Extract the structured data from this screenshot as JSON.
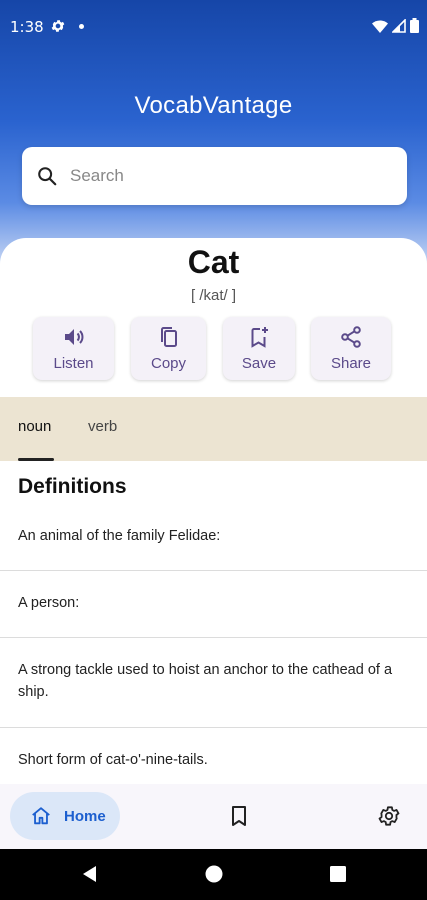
{
  "status_bar": {
    "time": "1:38"
  },
  "app": {
    "title": "VocabVantage"
  },
  "search": {
    "placeholder": "Search"
  },
  "entry": {
    "word": "Cat",
    "phonetic": "[ /kat/ ]"
  },
  "actions": [
    {
      "label": "Listen",
      "icon": "speaker-icon"
    },
    {
      "label": "Copy",
      "icon": "copy-icon"
    },
    {
      "label": "Save",
      "icon": "bookmark-add-icon"
    },
    {
      "label": "Share",
      "icon": "share-icon"
    }
  ],
  "tabs": [
    {
      "label": "noun",
      "selected": true
    },
    {
      "label": "verb",
      "selected": false
    }
  ],
  "definitions": {
    "heading": "Definitions",
    "items": [
      "An animal of the family Felidae:",
      "A person:",
      "A strong tackle used to hoist an anchor to the cathead of a ship.",
      "Short form of cat-o'-nine-tails."
    ]
  },
  "bottom_nav": {
    "home_label": "Home",
    "items": [
      "home-icon",
      "bookmark-icon",
      "settings-icon"
    ]
  },
  "colors": {
    "header_top": "#1646a8",
    "accent": "#1c5fcf",
    "action_text": "#5b4a8a",
    "tabs_bg": "#ece4d2"
  }
}
